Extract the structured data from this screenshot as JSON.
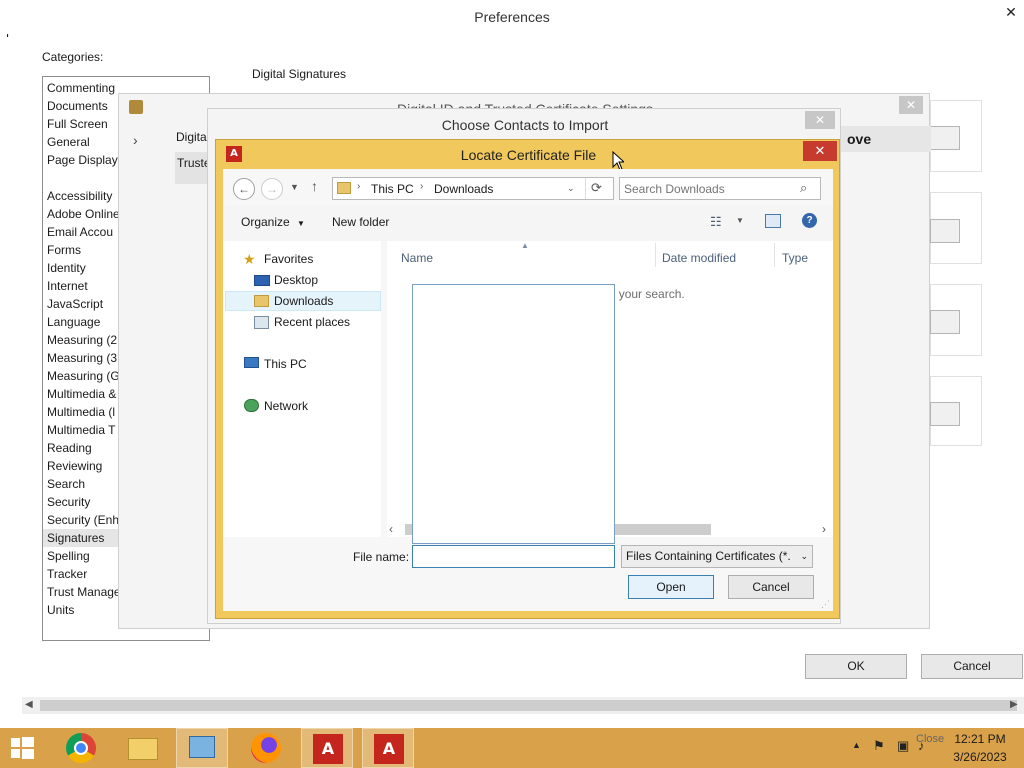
{
  "preferences": {
    "title": "Preferences",
    "close_glyph": "✕",
    "categories_label": "Categories:",
    "categories": [
      "Commenting",
      "Documents",
      "Full Screen",
      "General",
      "Page Display",
      "Accessibility",
      "Adobe Online",
      "Email Accou",
      "Forms",
      "Identity",
      "Internet",
      "JavaScript",
      "Language",
      "Measuring (2",
      "Measuring (3",
      "Measuring (G",
      "Multimedia &",
      "Multimedia (l",
      "Multimedia T",
      "Reading",
      "Reviewing",
      "Search",
      "Security",
      "Security (Enh",
      "Signatures",
      "Spelling",
      "Tracker",
      "Trust Manage",
      "Units"
    ],
    "selected_category": "Signatures",
    "section_label": "Digital Signatures",
    "ok_label": "OK",
    "cancel_label": "Cancel"
  },
  "digital_id_dialog": {
    "title": "Digital ID and Trusted Certificate Settings",
    "close_glyph": "✕",
    "tree_item_1": "Digita",
    "tree_item_2": "Truste",
    "column_partial": "ove"
  },
  "contacts_dialog": {
    "title": "Choose Contacts to Import",
    "close_glyph": "✕"
  },
  "locate_dialog": {
    "title": "Locate Certificate File",
    "close_glyph": "✕",
    "breadcrumb": [
      "This PC",
      "Downloads"
    ],
    "search_placeholder": "Search Downloads",
    "organize_label": "Organize",
    "new_folder_label": "New folder",
    "nav": {
      "favorites": "Favorites",
      "desktop": "Desktop",
      "downloads": "Downloads",
      "recent": "Recent places",
      "this_pc": "This PC",
      "network": "Network"
    },
    "columns": [
      "Name",
      "Date modified",
      "Type"
    ],
    "empty_message": "No items match your search.",
    "file_name_label": "File name:",
    "file_name_value": "",
    "file_type": "Files Containing Certificates (*.",
    "open_label": "Open",
    "cancel_label": "Cancel"
  },
  "taskbar": {
    "time": "12:21 PM",
    "date": "3/26/2023",
    "tooltip": "Close",
    "app_icons": [
      "windows-start-icon",
      "chrome-icon",
      "file-explorer-icon",
      "control-panel-icon",
      "firefox-icon",
      "acrobat-icon",
      "acrobat-reader-icon"
    ]
  },
  "colors": {
    "dialog_frame": "#f0c85c",
    "close_red": "#c73b2f",
    "taskbar": "#d9a24a",
    "adobe_red": "#c4261d",
    "link_blue": "#3c7fb1"
  }
}
